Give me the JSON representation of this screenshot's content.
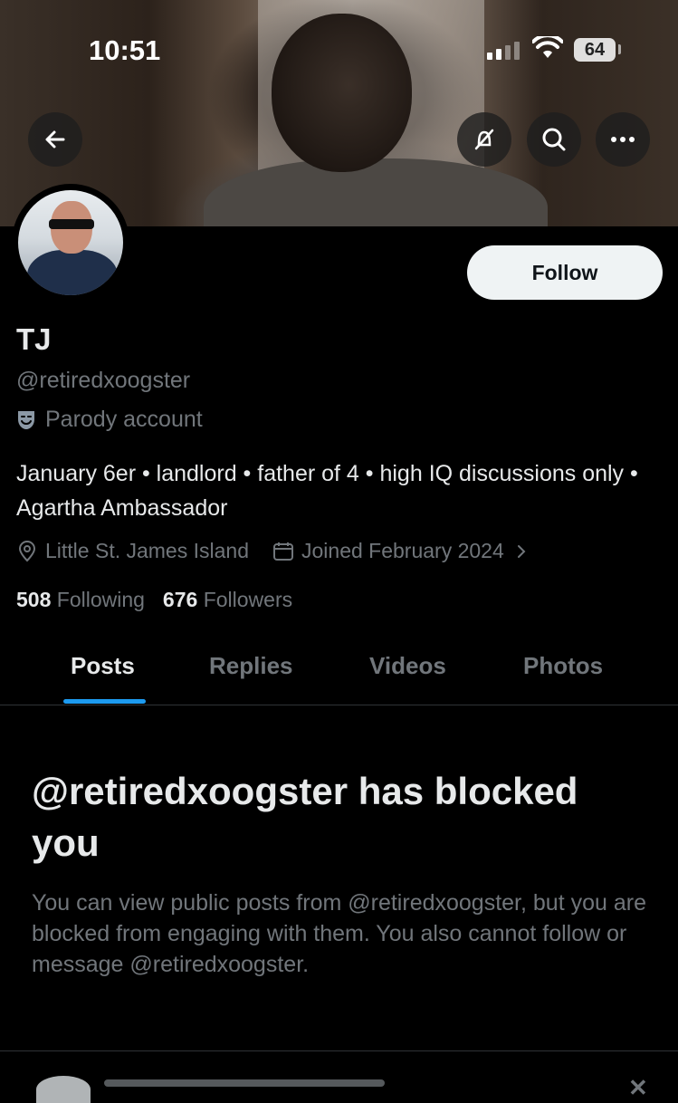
{
  "status_bar": {
    "time": "10:51",
    "battery": "64"
  },
  "profile": {
    "name": "TJ",
    "handle": "@retiredxoogster",
    "label": "Parody account",
    "bio": "January 6er • landlord • father of 4 • high IQ discussions only • Agartha Ambassador",
    "location": "Little St. James Island",
    "joined": "Joined February 2024",
    "following_count": "508",
    "following_label": "Following",
    "followers_count": "676",
    "followers_label": "Followers",
    "follow_button": "Follow"
  },
  "tabs": [
    {
      "label": "Posts",
      "active": true
    },
    {
      "label": "Replies",
      "active": false
    },
    {
      "label": "Videos",
      "active": false
    },
    {
      "label": "Photos",
      "active": false
    }
  ],
  "blocked": {
    "title": "@retiredxoogster has blocked you",
    "message": "You can view public posts from @retiredxoogster, but you are blocked from engaging with them. You also cannot follow or message @retiredxoogster."
  },
  "icons": {
    "back": "arrow-left-icon",
    "unsubscribe": "bell-slash-icon",
    "search": "search-icon",
    "more": "more-icon",
    "location": "location-pin-icon",
    "calendar": "calendar-icon",
    "parody": "theater-mask-icon"
  },
  "colors": {
    "accent": "#1d9bf0",
    "background": "#000000",
    "secondary_text": "#71767b"
  }
}
